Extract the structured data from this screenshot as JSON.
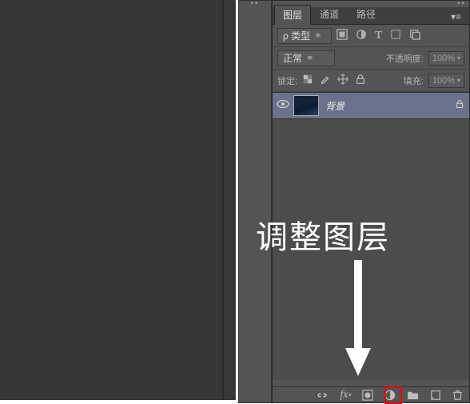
{
  "tabs": {
    "layers": "图层",
    "channels": "通道",
    "paths": "路径"
  },
  "filter_row": {
    "kind_label": "ρ 类型"
  },
  "blend_row": {
    "mode_label": "正常",
    "opacity_label": "不透明度:",
    "opacity_value": "100%"
  },
  "lock_row": {
    "lock_label": "锁定:",
    "fill_label": "填充:",
    "fill_value": "100%"
  },
  "layer": {
    "name": "背景"
  },
  "annotation": {
    "text": "调整图层"
  }
}
